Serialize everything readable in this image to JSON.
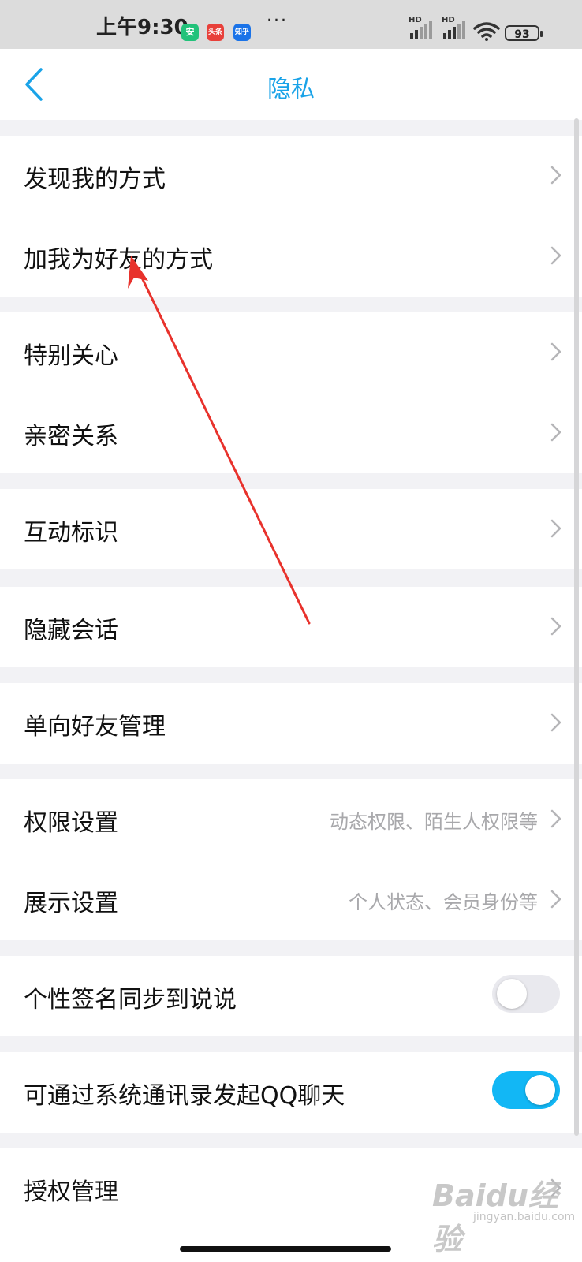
{
  "status_bar": {
    "time": "上午9:30",
    "apps": [
      "安",
      "头条",
      "知乎"
    ],
    "more": "···",
    "signal_labels": [
      "HD",
      "HD"
    ],
    "battery": "93"
  },
  "nav": {
    "back_icon": "chevron-left-icon",
    "title": "隐私"
  },
  "rows": {
    "find_me": "发现我的方式",
    "add_friend": "加我为好友的方式",
    "special_care": "特别关心",
    "intimate": "亲密关系",
    "interaction_mark": "互动标识",
    "hidden_chat": "隐藏会话",
    "one_way_friend": "单向好友管理",
    "permission": "权限设置",
    "permission_hint": "动态权限、陌生人权限等",
    "display": "展示设置",
    "display_hint": "个人状态、会员身份等",
    "signature_sync": "个性签名同步到说说",
    "signature_sync_on": false,
    "contacts_qq": "可通过系统通讯录发起QQ聊天",
    "contacts_qq_on": true,
    "auth": "授权管理"
  },
  "watermark": {
    "brand": "Baidu经验",
    "url": "jingyan.baidu.com"
  },
  "colors": {
    "accent": "#1aa3e8",
    "toggle_on": "#12b7f5",
    "annotation_arrow": "#e8322c"
  }
}
